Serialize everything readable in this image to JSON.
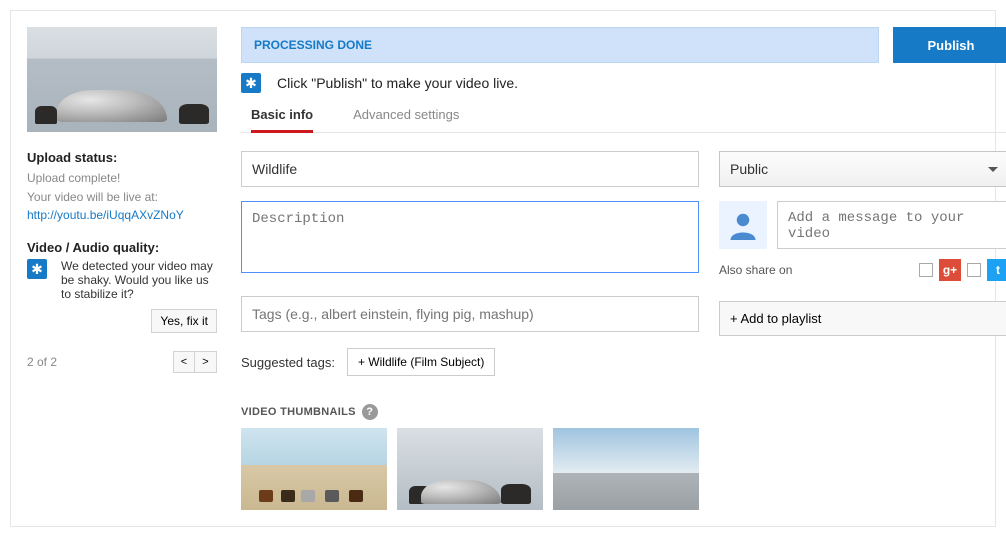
{
  "sidebar": {
    "upload_status_label": "Upload status:",
    "upload_status_text": "Upload complete!",
    "live_at_label": "Your video will be live at:",
    "video_url": "http://youtu.be/iUqqAXvZNoY",
    "quality_label": "Video / Audio quality:",
    "quality_msg": "We detected your video may be shaky. Would you like us to stabilize it?",
    "fix_button": "Yes, fix it",
    "pager_text": "2 of 2",
    "prev": "<",
    "next": ">"
  },
  "header": {
    "status_text": "PROCESSING DONE",
    "publish_button": "Publish",
    "hint_badge": "✱",
    "hint_text": "Click \"Publish\" to make your video live."
  },
  "tabs": {
    "basic": "Basic info",
    "advanced": "Advanced settings"
  },
  "form": {
    "title_value": "Wildlife",
    "description_placeholder": "Description",
    "tags_placeholder": "Tags (e.g., albert einstein, flying pig, mashup)",
    "suggested_label": "Suggested tags:",
    "suggested_chip": "+ Wildlife (Film Subject)"
  },
  "right": {
    "privacy_value": "Public",
    "message_placeholder": "Add a message to your video",
    "also_share": "Also share on",
    "gplus": "g+",
    "twitter": "t",
    "playlist_button": "+ Add to playlist"
  },
  "thumbs": {
    "header": "VIDEO THUMBNAILS",
    "help": "?"
  },
  "icons": {
    "star": "✱"
  }
}
